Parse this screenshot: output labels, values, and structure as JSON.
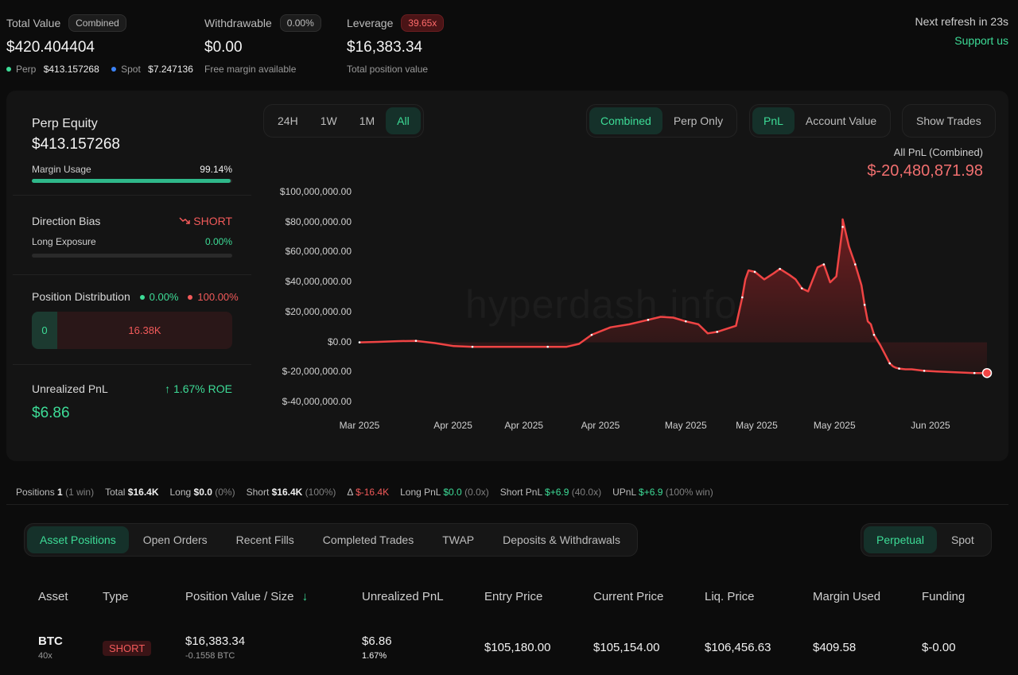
{
  "summary": {
    "total_value_label": "Total Value",
    "total_value_pill": "Combined",
    "total_value": "$420.404404",
    "perp_label": "Perp",
    "perp_value": "$413.157268",
    "spot_label": "Spot",
    "spot_value": "$7.247136",
    "withdrawable_label": "Withdrawable",
    "withdrawable_pill": "0.00%",
    "withdrawable_value": "$0.00",
    "withdrawable_sub": "Free margin available",
    "leverage_label": "Leverage",
    "leverage_pill": "39.65x",
    "leverage_value": "$16,383.34",
    "leverage_sub": "Total position value",
    "refresh_text": "Next refresh in 23s",
    "support_link": "Support us"
  },
  "left_panel": {
    "perp_equity_label": "Perp Equity",
    "perp_equity_value": "$413.157268",
    "margin_usage_label": "Margin Usage",
    "margin_usage_value": "99.14%",
    "margin_usage_fraction": 0.9914,
    "direction_bias_label": "Direction Bias",
    "direction_bias_value": "SHORT",
    "long_exposure_label": "Long Exposure",
    "long_exposure_value": "0.00%",
    "long_exposure_fraction": 0.0,
    "position_distribution_label": "Position Distribution",
    "dist_long_pct": "0.00%",
    "dist_short_pct": "100.00%",
    "dist_long_value": "0",
    "dist_short_value": "16.38K",
    "unrealized_label": "Unrealized PnL",
    "roe_value": "1.67% ROE",
    "unrealized_value": "$6.86"
  },
  "chart_controls": {
    "ranges": [
      "24H",
      "1W",
      "1M",
      "All"
    ],
    "active_range": "All",
    "modes": [
      "Combined",
      "Perp Only"
    ],
    "active_mode": "Combined",
    "metrics": [
      "PnL",
      "Account Value"
    ],
    "active_metric": "PnL",
    "show_trades_label": "Show Trades"
  },
  "chart_header": {
    "caption": "All PnL (Combined)",
    "value": "$-20,480,871.98",
    "watermark": "hyperdash.info"
  },
  "chart_data": {
    "type": "area",
    "title": "All PnL (Combined)",
    "ylim": [
      -40000000,
      100000000
    ],
    "y_ticks": [
      "$100,000,000.00",
      "$80,000,000.00",
      "$60,000,000.00",
      "$40,000,000.00",
      "$20,000,000.00",
      "$0.00",
      "$-20,000,000.00",
      "$-40,000,000.00"
    ],
    "x_ticks": [
      "Mar 2025",
      "Apr 2025",
      "Apr 2025",
      "Apr 2025",
      "May 2025",
      "May 2025",
      "May 2025",
      "Jun 2025"
    ],
    "grid": false,
    "series": [
      {
        "color": "#ef4444",
        "x": [
          0,
          0.03,
          0.06,
          0.09,
          0.12,
          0.15,
          0.18,
          0.22,
          0.26,
          0.3,
          0.33,
          0.35,
          0.37,
          0.4,
          0.43,
          0.46,
          0.48,
          0.5,
          0.52,
          0.54,
          0.555,
          0.57,
          0.585,
          0.6,
          0.61,
          0.615,
          0.62,
          0.63,
          0.645,
          0.66,
          0.67,
          0.685,
          0.695,
          0.705,
          0.715,
          0.73,
          0.74,
          0.75,
          0.76,
          0.77,
          0.77,
          0.78,
          0.79,
          0.795,
          0.8,
          0.805,
          0.81,
          0.815,
          0.82,
          0.83,
          0.84,
          0.845,
          0.85,
          0.855,
          0.86,
          0.87,
          0.88,
          0.9,
          0.92,
          0.95,
          0.98,
          1.0
        ],
        "y": [
          0,
          300000,
          800000,
          1000000,
          -500000,
          -2500000,
          -3000000,
          -3000000,
          -3000000,
          -3000000,
          -3000000,
          -1000000,
          5000000,
          10000000,
          12000000,
          15000000,
          17000000,
          16500000,
          14000000,
          12000000,
          6000000,
          7000000,
          9000000,
          11000000,
          30000000,
          42000000,
          48000000,
          47000000,
          42000000,
          46000000,
          49000000,
          45000000,
          42000000,
          36000000,
          34000000,
          50000000,
          52000000,
          40000000,
          44000000,
          77000000,
          82000000,
          64000000,
          52000000,
          45000000,
          38000000,
          25000000,
          14000000,
          12000000,
          5000000,
          -2000000,
          -10000000,
          -14000000,
          -16000000,
          -17000000,
          -17500000,
          -18000000,
          -18000000,
          -19000000,
          -19500000,
          -20000000,
          -20500000,
          -20480871.98
        ]
      }
    ]
  },
  "stats_bar": {
    "positions_label": "Positions",
    "positions_value": "1",
    "positions_note": "(1 win)",
    "total_label": "Total",
    "total_value": "$16.4K",
    "long_label": "Long",
    "long_value": "$0.0",
    "long_note": "(0%)",
    "short_label": "Short",
    "short_value": "$16.4K",
    "short_note": "(100%)",
    "delta_label": "Δ",
    "delta_value": "$-16.4K",
    "long_pnl_label": "Long PnL",
    "long_pnl_value": "$0.0",
    "long_pnl_note": "(0.0x)",
    "short_pnl_label": "Short PnL",
    "short_pnl_value": "$+6.9",
    "short_pnl_note": "(40.0x)",
    "upnl_label": "UPnL",
    "upnl_value": "$+6.9",
    "upnl_note": "(100% win)"
  },
  "tabs": {
    "items": [
      "Asset Positions",
      "Open Orders",
      "Recent Fills",
      "Completed Trades",
      "TWAP",
      "Deposits & Withdrawals"
    ],
    "active": "Asset Positions",
    "market_items": [
      "Perpetual",
      "Spot"
    ],
    "market_active": "Perpetual"
  },
  "table": {
    "headers": [
      "Asset",
      "Type",
      "Position Value / Size",
      "Unrealized PnL",
      "Entry Price",
      "Current Price",
      "Liq. Price",
      "Margin Used",
      "Funding"
    ],
    "row": {
      "asset": "BTC",
      "leverage": "40x",
      "type": "SHORT",
      "position_value": "$16,383.34",
      "size": "-0.1558 BTC",
      "unrealized": "$6.86",
      "unrealized_pct": "1.67%",
      "entry_price": "$105,180.00",
      "current_price": "$105,154.00",
      "liq_price": "$106,456.63",
      "margin_used": "$409.58",
      "funding": "$-0.00"
    }
  }
}
